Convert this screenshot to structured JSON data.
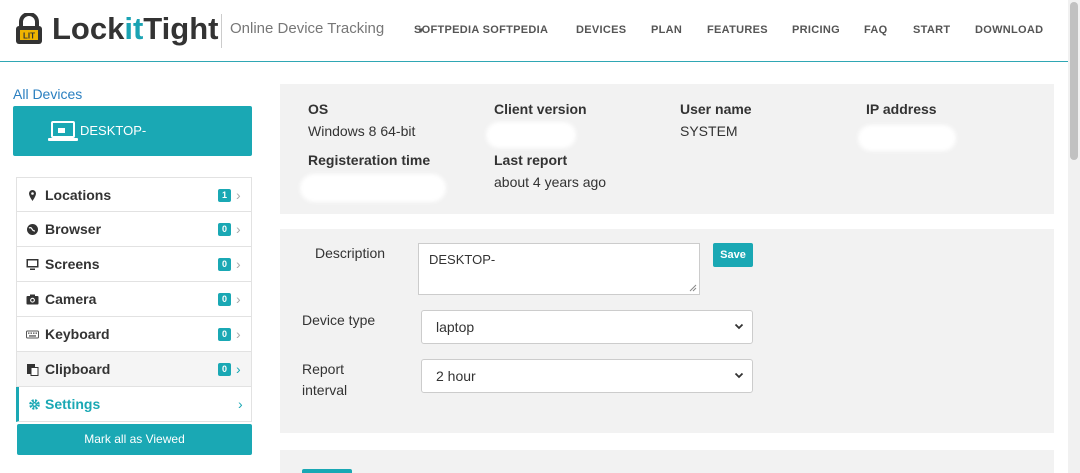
{
  "brand": {
    "name_prefix": "Lock",
    "name_highlight": "it",
    "name_suffix": "Tight",
    "tagline": "Online Device Tracking",
    "accent_color": "#1aa8b4"
  },
  "nav": {
    "items": [
      {
        "label": "SOFTPEDIA SOFTPEDIA",
        "has_dropdown": true
      },
      {
        "label": "DEVICES"
      },
      {
        "label": "PLAN"
      },
      {
        "label": "FEATURES"
      },
      {
        "label": "PRICING"
      },
      {
        "label": "FAQ"
      },
      {
        "label": "START"
      },
      {
        "label": "DOWNLOAD"
      }
    ]
  },
  "sidebar": {
    "all_devices_label": "All Devices",
    "device_name": "DESKTOP-",
    "device_icon": "laptop-icon",
    "menu": [
      {
        "label": "Locations",
        "icon": "map-pin-icon",
        "count": "1"
      },
      {
        "label": "Browser",
        "icon": "globe-icon",
        "count": "0"
      },
      {
        "label": "Screens",
        "icon": "monitor-icon",
        "count": "0"
      },
      {
        "label": "Camera",
        "icon": "camera-icon",
        "count": "0"
      },
      {
        "label": "Keyboard",
        "icon": "keyboard-icon",
        "count": "0"
      },
      {
        "label": "Clipboard",
        "icon": "clipboard-icon",
        "count": "0"
      },
      {
        "label": "Settings",
        "icon": "gear-icon",
        "active": true
      }
    ],
    "mark_all_label": "Mark all as Viewed"
  },
  "info": {
    "os_label": "OS",
    "os_value": "Windows 8 64-bit",
    "client_version_label": "Client version",
    "user_name_label": "User name",
    "user_name_value": "SYSTEM",
    "ip_label": "IP address",
    "reg_time_label": "Registeration time",
    "last_report_label": "Last report",
    "last_report_value": "about 4 years ago"
  },
  "settings": {
    "description_label": "Description",
    "description_value": "DESKTOP-",
    "save_label": "Save",
    "device_type_label": "Device type",
    "device_type_value": "laptop",
    "report_interval_label": "Report interval",
    "report_interval_value": "2 hour"
  }
}
